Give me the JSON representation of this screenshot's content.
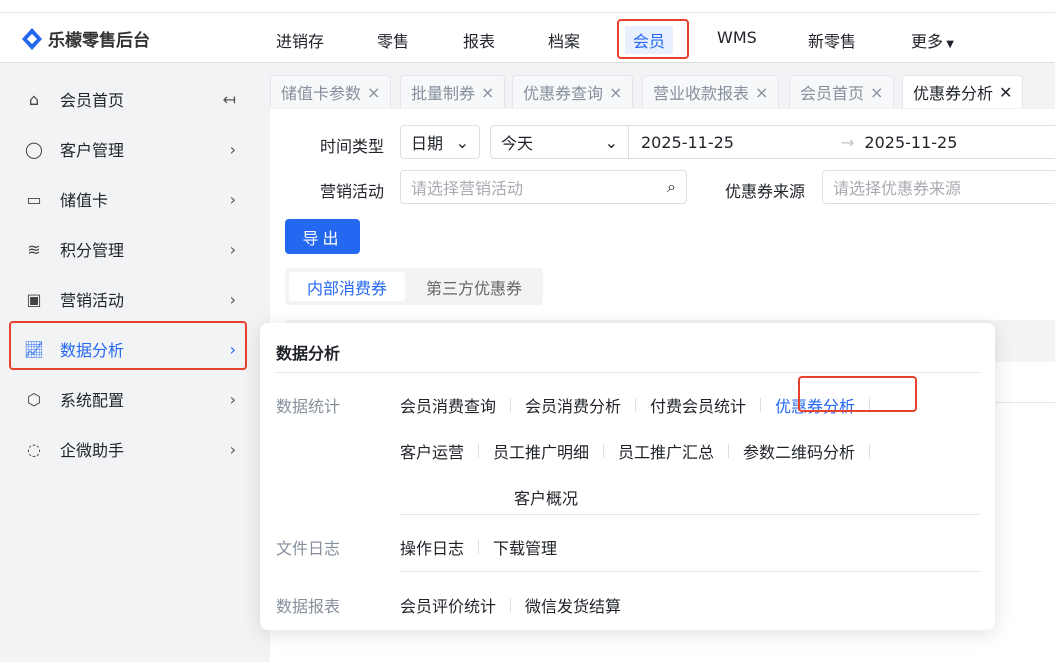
{
  "app": {
    "title": "乐檬零售后台"
  },
  "nav": {
    "items": [
      "进销存",
      "零售",
      "报表",
      "档案",
      "会员",
      "WMS",
      "新零售",
      "更多"
    ],
    "active": "会员"
  },
  "sidebar": {
    "items": [
      {
        "label": "会员首页",
        "icon": "home-icon"
      },
      {
        "label": "客户管理",
        "icon": "user-icon"
      },
      {
        "label": "储值卡",
        "icon": "card-icon"
      },
      {
        "label": "积分管理",
        "icon": "database-icon"
      },
      {
        "label": "营销活动",
        "icon": "monitor-chart-icon"
      },
      {
        "label": "数据分析",
        "icon": "line-chart-icon"
      },
      {
        "label": "系统配置",
        "icon": "settings-icon"
      },
      {
        "label": "企微助手",
        "icon": "chat-icon"
      }
    ],
    "active": "数据分析"
  },
  "tabs": [
    "储值卡参数",
    "批量制券",
    "优惠券查询",
    "营业收款报表",
    "会员首页",
    "优惠券分析"
  ],
  "filters": {
    "time_type_label": "时间类型",
    "time_type_value": "日期",
    "range_value": "今天",
    "start_date": "2025-11-25",
    "end_date": "2025-11-25",
    "activity_label": "营销活动",
    "activity_placeholder": "请选择营销活动",
    "source_label": "优惠券来源",
    "source_placeholder": "请选择优惠券来源"
  },
  "export_label": "导出",
  "segments": [
    "内部消费券",
    "第三方优惠券"
  ],
  "popup": {
    "title": "数据分析",
    "groups": [
      {
        "name": "数据统计",
        "links": [
          "会员消费查询",
          "会员消费分析",
          "付费会员统计",
          "优惠券分析",
          "客户运营",
          "员工推广明细",
          "员工推广汇总",
          "参数二维码分析",
          "客户概况"
        ]
      },
      {
        "name": "文件日志",
        "links": [
          "操作日志",
          "下载管理"
        ]
      },
      {
        "name": "数据报表",
        "links": [
          "会员评价统计",
          "微信发货结算"
        ]
      }
    ],
    "active_link": "优惠券分析"
  },
  "colors": {
    "accent": "#2468f2",
    "highlight": "#e5412d"
  }
}
